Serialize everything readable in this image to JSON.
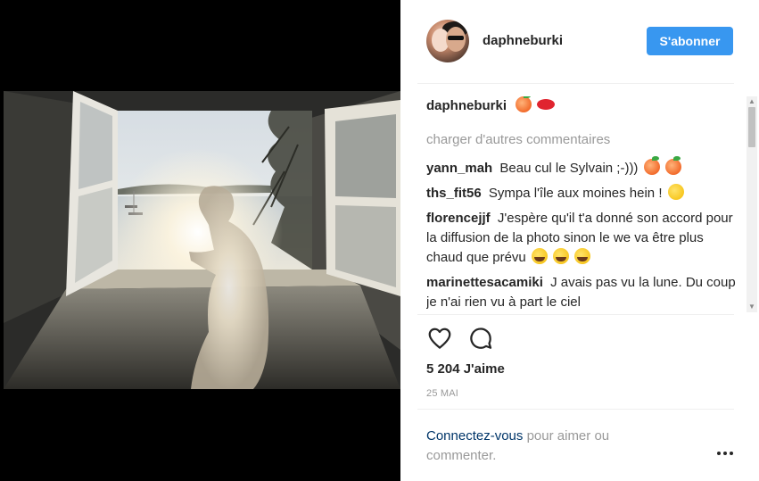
{
  "post": {
    "username": "daphneburki",
    "follow_label": "S'abonner",
    "caption_user": "daphneburki",
    "caption_emojis": [
      "peach",
      "lips"
    ],
    "load_more_label": "charger d'autres commentaires",
    "comments": [
      {
        "user": "yann_mah",
        "text": "Beau cul le Sylvain ;-)))",
        "emojis": [
          "peach",
          "peach"
        ]
      },
      {
        "user": "ths_fit56",
        "text": "Sympa l'île aux moines hein !",
        "emojis": [
          "wink"
        ]
      },
      {
        "user": "florencejjf",
        "text": "J'espère qu'il t'a donné son accord pour la diffusion de la photo sinon le we va être plus chaud que prévu",
        "emojis": [
          "joy",
          "joy",
          "joy"
        ]
      },
      {
        "user": "marinettesacamiki",
        "text": "J avais pas vu la lune. Du coup je n'ai rien vu à part le ciel",
        "emojis": []
      }
    ],
    "likes": "5 204 J'aime",
    "date": "25 MAI",
    "login_link": "Connectez-vous",
    "login_text": " pour aimer ou commenter."
  },
  "icons": {
    "like": "heart-icon",
    "comment": "speech-bubble-icon",
    "more": "ellipsis-icon"
  },
  "colors": {
    "follow_button": "#3897f0",
    "link": "#003569",
    "muted": "#999999",
    "text": "#262626"
  }
}
